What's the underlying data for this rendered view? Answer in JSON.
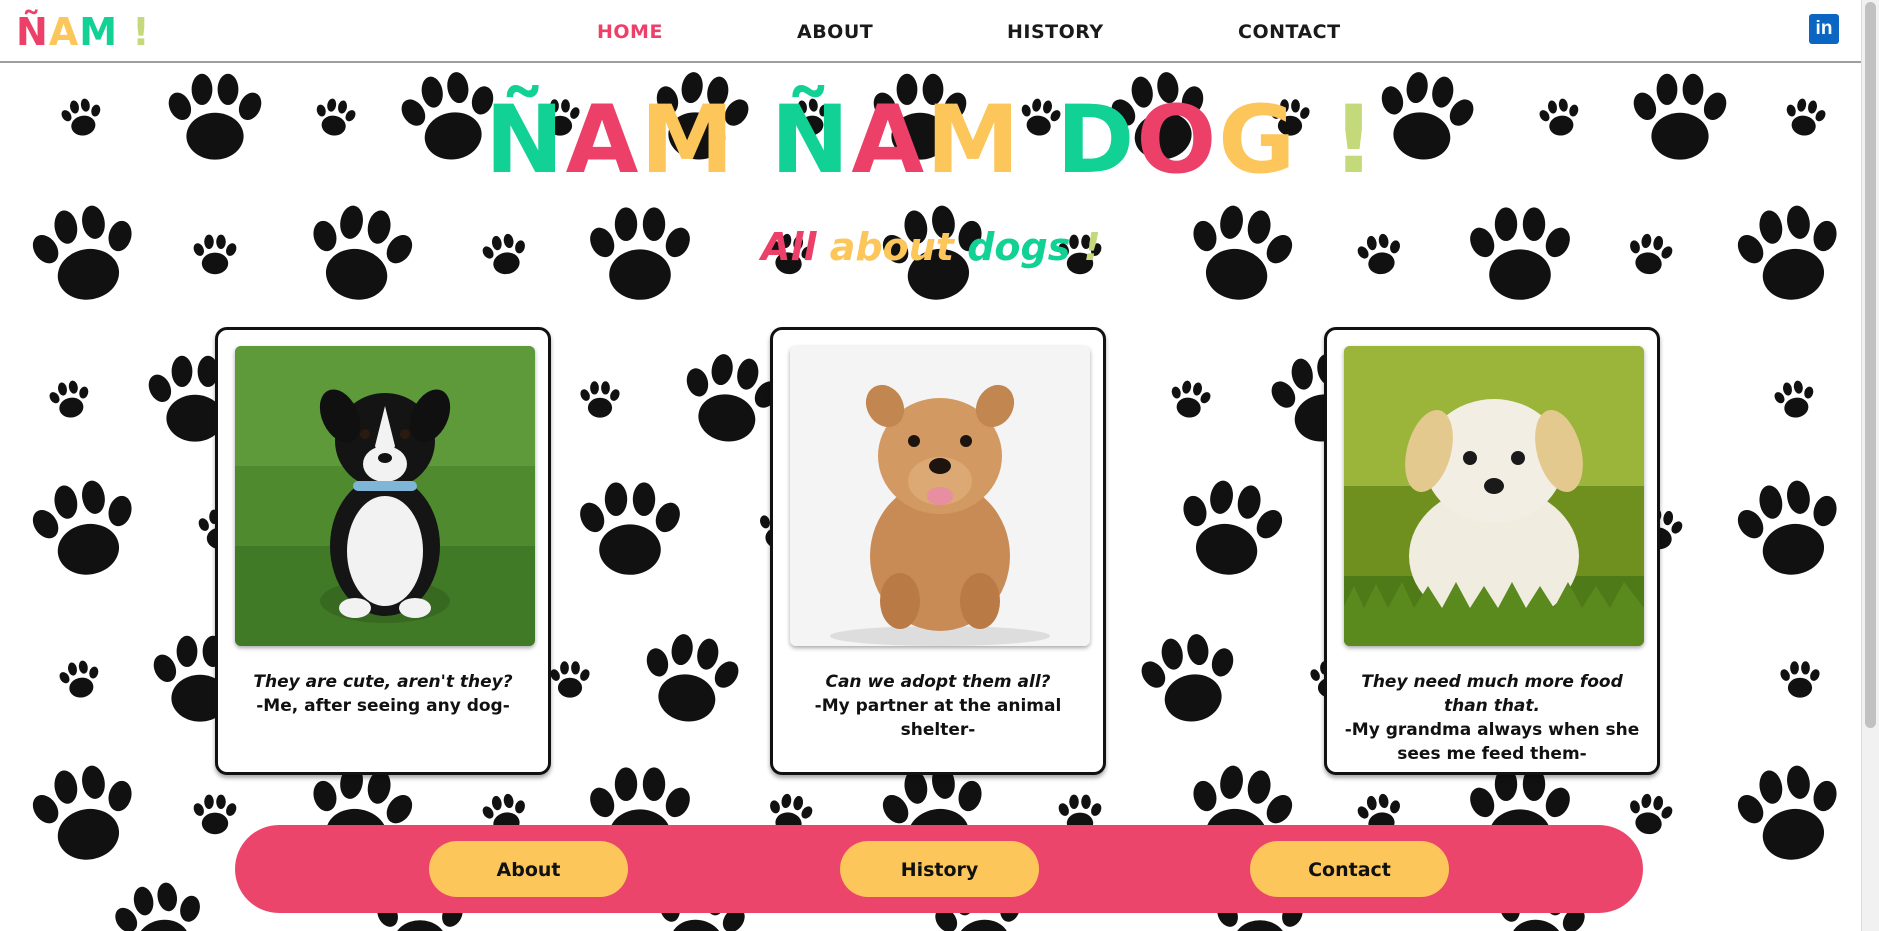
{
  "navbar": {
    "logo": [
      "Ñ",
      "A",
      "M",
      " !"
    ],
    "links": [
      "HOME",
      "ABOUT",
      "HISTORY",
      "CONTACT"
    ],
    "social": "in"
  },
  "hero": {
    "title_letters": [
      "Ñ",
      "A",
      "M",
      " ",
      "Ñ",
      "A",
      "M",
      " ",
      "D",
      "O",
      "G",
      " !"
    ],
    "subtitle_words": [
      "All",
      " about",
      " dogs",
      " !"
    ]
  },
  "colors": {
    "pink": "#ec4069",
    "yellow": "#fcc65a",
    "green": "#11d294",
    "lime": "#c3d97a",
    "linkedin": "#0a66c2"
  },
  "cards": [
    {
      "photo_alt": "black-and-white-puppy",
      "quote": "They are cute, aren't they?",
      "author": "-Me, after seeing any dog-"
    },
    {
      "photo_alt": "terrier-dog",
      "quote": "Can we adopt them all?",
      "author": "-My partner at the animal shelter-"
    },
    {
      "photo_alt": "white-puppy",
      "quote": "They need much more food than that.",
      "author": "-My grandma always when she sees me feed them-"
    }
  ],
  "footer": {
    "buttons": [
      "About",
      "History",
      "Contact"
    ]
  }
}
